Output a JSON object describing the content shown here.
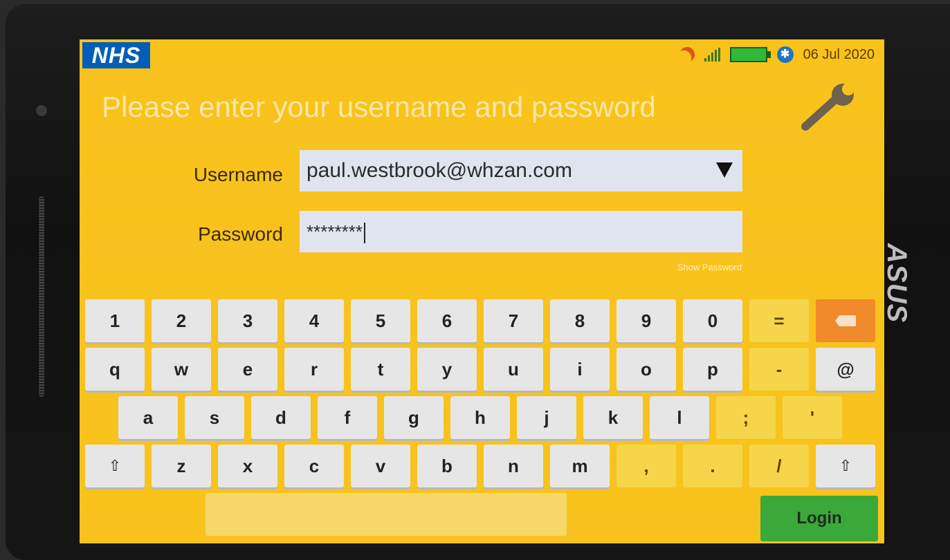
{
  "status": {
    "logo": "NHS",
    "date": "06 Jul 2020"
  },
  "login": {
    "prompt": "Please enter your username and password",
    "username_label": "Username",
    "username_value": "paul.westbrook@whzan.com",
    "password_label": "Password",
    "password_value": "********",
    "show_password": "Show Password",
    "login_button": "Login"
  },
  "device": {
    "brand": "ASUS"
  },
  "keyboard": {
    "row1": [
      "1",
      "2",
      "3",
      "4",
      "5",
      "6",
      "7",
      "8",
      "9",
      "0",
      "="
    ],
    "row2": [
      "q",
      "w",
      "e",
      "r",
      "t",
      "y",
      "u",
      "i",
      "o",
      "p",
      "-",
      "@"
    ],
    "row3": [
      "a",
      "s",
      "d",
      "f",
      "g",
      "h",
      "j",
      "k",
      "l",
      ";",
      "'"
    ],
    "row4": [
      "z",
      "x",
      "c",
      "v",
      "b",
      "n",
      "m",
      ",",
      ".",
      "/"
    ]
  }
}
